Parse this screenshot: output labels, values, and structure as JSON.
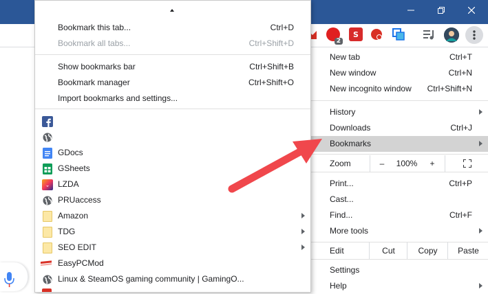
{
  "window": {
    "titlebar_color": "#2b5797",
    "minimize": "minimize-icon",
    "restore": "restore-icon",
    "close": "close-icon"
  },
  "extensions": [
    {
      "name": "gmail-icon",
      "color": "#d93025"
    },
    {
      "name": "opera-extension-icon",
      "color": "#e02020",
      "badge": "2"
    },
    {
      "name": "s-extension-icon",
      "color": "#d72b2b",
      "label": "S"
    },
    {
      "name": "shield-extension-icon",
      "color": "#d93025"
    },
    {
      "name": "screenshot-extension-icon",
      "color": "#1a73e8"
    },
    {
      "name": "media-playlist-icon",
      "color": "#5f6368"
    },
    {
      "name": "profile-avatar",
      "color": "#3c4043"
    },
    {
      "name": "more-menu-icon",
      "color": "#5f6368"
    }
  ],
  "bookmarks_menu": {
    "top_items": [
      {
        "label": "Bookmark this tab...",
        "shortcut": "Ctrl+D",
        "enabled": true
      },
      {
        "label": "Bookmark all tabs...",
        "shortcut": "Ctrl+Shift+D",
        "enabled": false
      }
    ],
    "manage_items": [
      {
        "label": "Show bookmarks bar",
        "shortcut": "Ctrl+Shift+B"
      },
      {
        "label": "Bookmark manager",
        "shortcut": "Ctrl+Shift+O"
      },
      {
        "label": "Import bookmarks and settings...",
        "shortcut": ""
      }
    ],
    "bookmarks": [
      {
        "label": "",
        "icon": "facebook-icon",
        "folder": false
      },
      {
        "label": "",
        "icon": "globe-icon",
        "folder": false
      },
      {
        "label": "GDocs",
        "icon": "google-docs-icon",
        "folder": false
      },
      {
        "label": "GSheets",
        "icon": "google-sheets-icon",
        "folder": false
      },
      {
        "label": "LZDA",
        "icon": "lazada-icon",
        "folder": false
      },
      {
        "label": "PRUaccess",
        "icon": "globe-icon",
        "folder": false
      },
      {
        "label": "Amazon",
        "icon": "folder-icon",
        "folder": true
      },
      {
        "label": "TDG",
        "icon": "folder-icon",
        "folder": true
      },
      {
        "label": "SEO EDIT",
        "icon": "folder-icon",
        "folder": true
      },
      {
        "label": "EasyPCMod",
        "icon": "easypcmod-icon",
        "folder": false
      },
      {
        "label": "Linux & SteamOS gaming community | GamingO...",
        "icon": "globe-icon",
        "folder": false
      }
    ]
  },
  "chrome_menu": {
    "group1": [
      {
        "label": "New tab",
        "shortcut": "Ctrl+T"
      },
      {
        "label": "New window",
        "shortcut": "Ctrl+N"
      },
      {
        "label": "New incognito window",
        "shortcut": "Ctrl+Shift+N"
      }
    ],
    "group2": [
      {
        "label": "History",
        "shortcut": "",
        "submenu": true
      },
      {
        "label": "Downloads",
        "shortcut": "Ctrl+J",
        "submenu": false
      },
      {
        "label": "Bookmarks",
        "shortcut": "",
        "submenu": true,
        "highlighted": true
      }
    ],
    "zoom": {
      "label": "Zoom",
      "minus": "–",
      "value": "100%",
      "plus": "+",
      "fullscreen_icon": "fullscreen-icon"
    },
    "group3": [
      {
        "label": "Print...",
        "shortcut": "Ctrl+P",
        "submenu": false
      },
      {
        "label": "Cast...",
        "shortcut": "",
        "submenu": false
      },
      {
        "label": "Find...",
        "shortcut": "Ctrl+F",
        "submenu": false
      },
      {
        "label": "More tools",
        "shortcut": "",
        "submenu": true
      }
    ],
    "edit": {
      "label": "Edit",
      "cut": "Cut",
      "copy": "Copy",
      "paste": "Paste"
    },
    "group4": [
      {
        "label": "Settings",
        "submenu": false
      },
      {
        "label": "Help",
        "submenu": true
      }
    ]
  },
  "annotation": {
    "arrow_color": "#f0474c"
  }
}
